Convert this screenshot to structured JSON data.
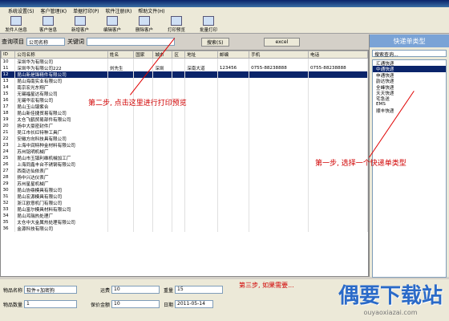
{
  "menu": [
    "系统设置(S)",
    "客户管理(K)",
    "单据打印(P)",
    "软件注册(R)",
    "帮助文件(H)"
  ],
  "toolbar": [
    "发件人信息",
    "客户信息",
    "新增客户",
    "编辑客户",
    "删除客户",
    "打印预览",
    "批量打印"
  ],
  "search": {
    "label_item": "查询项目",
    "field_value": "公司名称",
    "label_kw": "关键词",
    "search_btn": "搜索(S)",
    "excel_btn": "excel"
  },
  "grid": {
    "columns": [
      "ID",
      "公司名称",
      "姓名",
      "国家",
      "城市",
      "区",
      "地址",
      "邮编",
      "手机",
      "电话"
    ],
    "rows": [
      [
        "10",
        "深圳华为有限公司",
        "",
        "",
        "",
        "",
        "",
        "",
        "",
        ""
      ],
      [
        "11",
        "深圳华为有限公司222",
        "刘先生",
        "",
        "深圳",
        "",
        "深南大道",
        "123456",
        "0755-88238888",
        "0755-88238888"
      ],
      [
        "12",
        "昆山新是锋精件有限公司",
        "",
        "",
        "",
        "",
        "",
        "",
        "",
        ""
      ],
      [
        "13",
        "昆山海南实业有限公司",
        "",
        "",
        "",
        "",
        "",
        "",
        "",
        ""
      ],
      [
        "14",
        "南京宏光东翔厂",
        "",
        "",
        "",
        "",
        "",
        "",
        "",
        ""
      ],
      [
        "15",
        "无锡福星达有限公司",
        "",
        "",
        "",
        "",
        "",
        "",
        "",
        ""
      ],
      [
        "16",
        "无锡华宏有限公司",
        "",
        "",
        "",
        "",
        "",
        "",
        "",
        ""
      ],
      [
        "17",
        "昆山玉山镇紫合",
        "",
        "",
        "",
        "",
        "",
        "",
        "",
        ""
      ],
      [
        "18",
        "昆山新佳捷贸易有限公司",
        "",
        "",
        "",
        "",
        "",
        "",
        "",
        ""
      ],
      [
        "19",
        "太仓飞鹤贸易部件有限公司",
        "",
        "",
        "",
        "",
        "",
        "",
        "",
        ""
      ],
      [
        "20",
        "扬中大豪密封件厂",
        "",
        "",
        "",
        "",
        "",
        "",
        "",
        ""
      ],
      [
        "21",
        "吴江市长红特种工具厂",
        "",
        "",
        "",
        "",
        "",
        "",
        "",
        ""
      ],
      [
        "22",
        "安徽方向科技具有限公司",
        "",
        "",
        "",
        "",
        "",
        "",
        "",
        ""
      ],
      [
        "23",
        "上海中润特种金材料有限公司",
        "",
        "",
        "",
        "",
        "",
        "",
        "",
        ""
      ],
      [
        "24",
        "苏州铭明机械厂",
        "",
        "",
        "",
        "",
        "",
        "",
        "",
        ""
      ],
      [
        "25",
        "昆山市玉镇利维机械加工厂",
        "",
        "",
        "",
        "",
        "",
        "",
        "",
        ""
      ],
      [
        "26",
        "上海同鑫丰台不锈钢有限公司",
        "",
        "",
        "",
        "",
        "",
        "",
        "",
        ""
      ],
      [
        "27",
        "西南达仙依表厂",
        "",
        "",
        "",
        "",
        "",
        "",
        "",
        ""
      ],
      [
        "28",
        "扬中兴达仪表厂",
        "",
        "",
        "",
        "",
        "",
        "",
        "",
        ""
      ],
      [
        "29",
        "苏州星星机械厂",
        "",
        "",
        "",
        "",
        "",
        "",
        "",
        ""
      ],
      [
        "30",
        "昆山协鼎模具有限公司",
        "",
        "",
        "",
        "",
        "",
        "",
        "",
        ""
      ],
      [
        "31",
        "昆山宏源模具有限公司",
        "",
        "",
        "",
        "",
        "",
        "",
        "",
        ""
      ],
      [
        "32",
        "浙江欧意机门有限公司",
        "",
        "",
        "",
        "",
        "",
        "",
        "",
        ""
      ],
      [
        "33",
        "昆山富尔模具材料有限公司",
        "",
        "",
        "",
        "",
        "",
        "",
        "",
        ""
      ],
      [
        "34",
        "昆山鸿瑞热处理厂",
        "",
        "",
        "",
        "",
        "",
        "",
        "",
        ""
      ],
      [
        "35",
        "太仓中大金属热处理有限公司",
        "",
        "",
        "",
        "",
        "",
        "",
        "",
        ""
      ],
      [
        "36",
        "金源科技有限公司",
        "",
        "",
        "",
        "",
        "",
        "",
        "",
        ""
      ]
    ]
  },
  "right_panel": {
    "title": "快递单类型",
    "search_placeholder": "搜索查询...",
    "items": [
      "汇通快递",
      "中通快递",
      "申通快递",
      "韵达快递",
      "全峰快递",
      "天天快递",
      "宅急送",
      "EMS",
      "顺丰快递"
    ]
  },
  "form": {
    "item_name_label": "物品名称",
    "item_name": "软件+加密狗",
    "freight_label": "运费",
    "freight": "10",
    "weight_label": "重量",
    "weight": "15",
    "item_count_label": "物品数量",
    "item_count": "1",
    "insured_label": "保价金额",
    "insured": "10",
    "date_label": "日期",
    "date": "2011-05-14"
  },
  "annotations": {
    "step1": "第一步, 选择一个快递单类型",
    "step2": "第二步, 点击这里进行打印预览",
    "step3": "第三步, 如果需要..."
  },
  "watermark": {
    "big": "偶要下载站",
    "small": "ouyaoxiazai.com"
  }
}
